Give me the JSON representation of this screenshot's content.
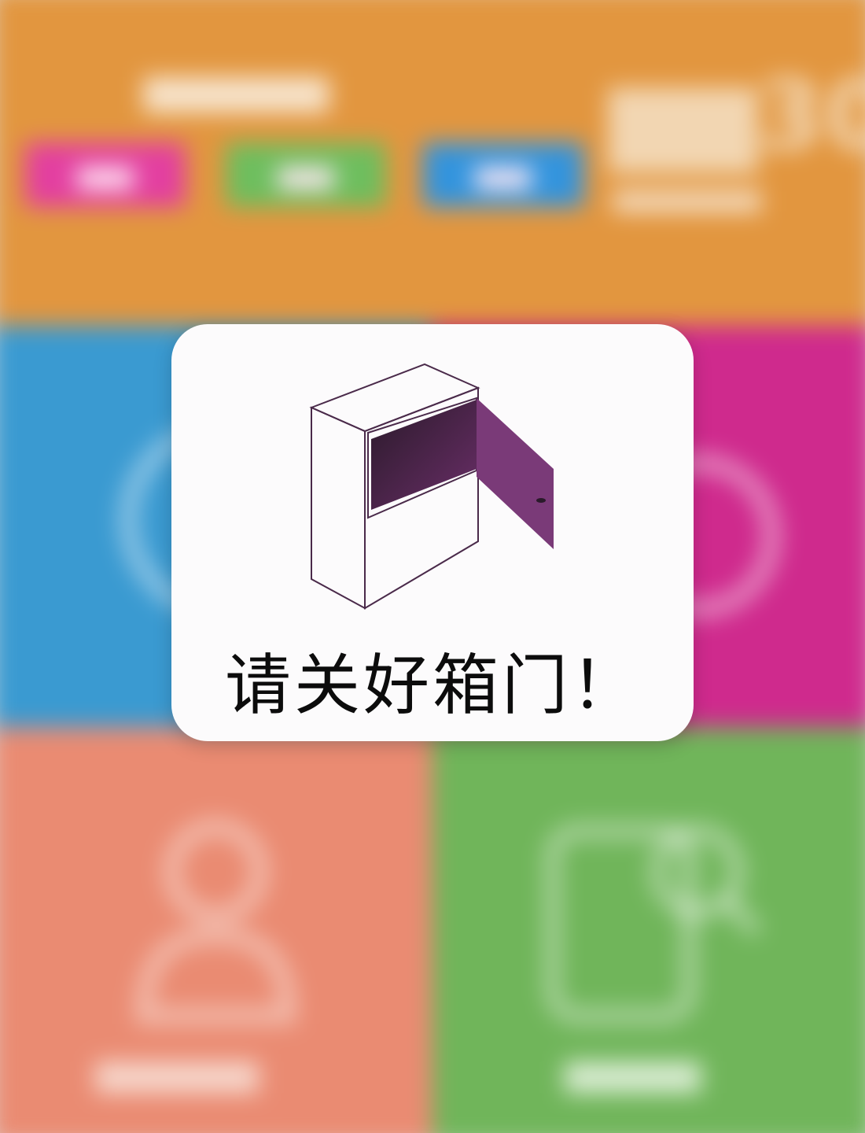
{
  "colors": {
    "top_panel": "#e2963f",
    "tile_blue": "#3a9ad1",
    "tile_magenta": "#cf2a8d",
    "tile_salmon": "#ea8b72",
    "tile_green": "#70b55a",
    "door_purple": "#7a3a78",
    "dialog_bg": "#fcfbfc"
  },
  "dialog": {
    "message": "请关好箱门！",
    "icon": "open-locker-door-icon"
  },
  "background": {
    "icons": [
      "user-icon",
      "search-document-icon"
    ]
  }
}
